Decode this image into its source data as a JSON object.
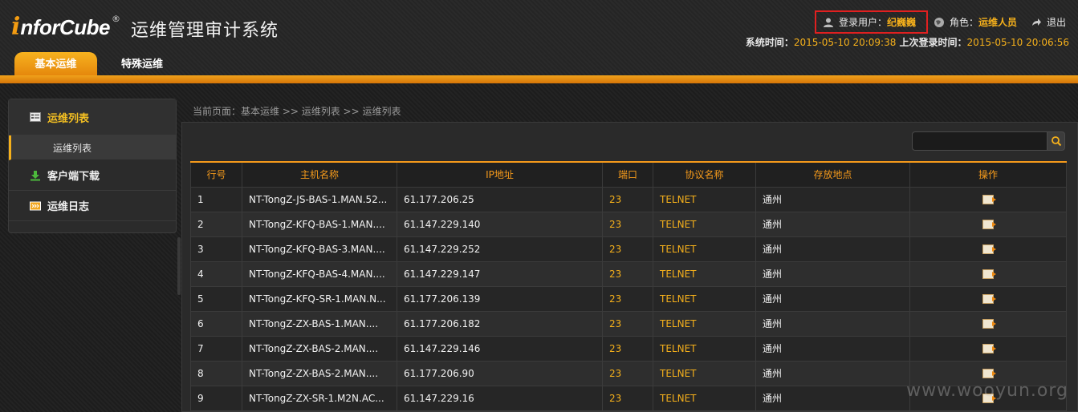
{
  "header": {
    "logo_mark": "i",
    "logo_text": "nforCube",
    "logo_reg": "®",
    "system_title": "运维管理审计系统",
    "user_label": "登录用户：",
    "user_name": "纪巍巍",
    "role_label": "角色：",
    "role_name": "运维人员",
    "logout_label": "退出",
    "system_time_label": "系统时间：",
    "system_time": "2015-05-10 20:09:38",
    "last_login_label": "上次登录时间：",
    "last_login": "2015-05-10 20:06:56",
    "tabs": [
      {
        "label": "基本运维",
        "active": true
      },
      {
        "label": "特殊运维",
        "active": false
      }
    ]
  },
  "sidebar": {
    "items": [
      {
        "label": "运维列表",
        "icon": "list-icon"
      },
      {
        "label": "运维列表",
        "icon": "",
        "sub": true
      },
      {
        "label": "客户端下载",
        "icon": "download-icon"
      },
      {
        "label": "运维日志",
        "icon": "log-icon"
      }
    ]
  },
  "breadcrumb": "当前页面：基本运维 >> 运维列表 >> 运维列表",
  "search": {
    "value": "",
    "placeholder": ""
  },
  "table": {
    "headers": [
      "行号",
      "主机名称",
      "IP地址",
      "端口",
      "协议名称",
      "存放地点",
      "操作"
    ],
    "rows": [
      [
        "1",
        "NT-TongZ-JS-BAS-1.MAN.52...",
        "61.177.206.25",
        "23",
        "TELNET",
        "通州"
      ],
      [
        "2",
        "NT-TongZ-KFQ-BAS-1.MAN....",
        "61.147.229.140",
        "23",
        "TELNET",
        "通州"
      ],
      [
        "3",
        "NT-TongZ-KFQ-BAS-3.MAN....",
        "61.147.229.252",
        "23",
        "TELNET",
        "通州"
      ],
      [
        "4",
        "NT-TongZ-KFQ-BAS-4.MAN....",
        "61.147.229.147",
        "23",
        "TELNET",
        "通州"
      ],
      [
        "5",
        "NT-TongZ-KFQ-SR-1.MAN.N...",
        "61.177.206.139",
        "23",
        "TELNET",
        "通州"
      ],
      [
        "6",
        "NT-TongZ-ZX-BAS-1.MAN....",
        "61.177.206.182",
        "23",
        "TELNET",
        "通州"
      ],
      [
        "7",
        "NT-TongZ-ZX-BAS-2.MAN....",
        "61.147.229.146",
        "23",
        "TELNET",
        "通州"
      ],
      [
        "8",
        "NT-TongZ-ZX-BAS-2.MAN....",
        "61.177.206.90",
        "23",
        "TELNET",
        "通州"
      ],
      [
        "9",
        "NT-TongZ-ZX-SR-1.M2N.AC...",
        "61.147.229.16",
        "23",
        "TELNET",
        "通州"
      ]
    ]
  },
  "watermark": "www.wooyun.org",
  "colors": {
    "accent": "#f5b01b",
    "highlight_box": "#e02020"
  }
}
